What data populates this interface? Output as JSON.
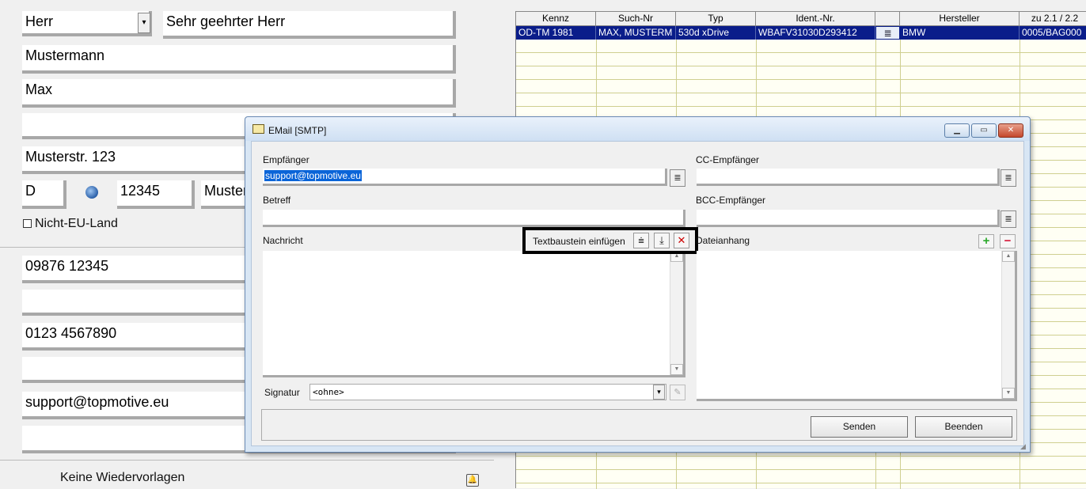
{
  "customer": {
    "salutation": "Herr",
    "letter_salutation": "Sehr geehrter Herr",
    "last_name": "Mustermann",
    "first_name": "Max",
    "street": "Musterstr. 123",
    "country": "D",
    "zip": "12345",
    "city": "Muster",
    "non_eu_label": "Nicht-EU-Land",
    "phone": "09876 12345",
    "mobile": "0123 4567890",
    "email": "support@topmotive.eu",
    "followups": "Keine Wiedervorlagen"
  },
  "vehicles": {
    "columns": [
      "Kennz",
      "Such-Nr",
      "Typ",
      "Ident.-Nr.",
      "",
      "Hersteller",
      "zu 2.1 / 2.2"
    ],
    "rows": [
      [
        "OD-TM 1981",
        "MAX, MUSTERM",
        "530d xDrive",
        "WBAFV31030D293412",
        "≣",
        "BMW",
        "0005/BAG000"
      ]
    ]
  },
  "email_dialog": {
    "title": "EMail [SMTP]",
    "recipient_label": "Empfänger",
    "recipient_value": "support@topmotive.eu",
    "cc_label": "CC-Empfänger",
    "subject_label": "Betreff",
    "bcc_label": "BCC-Empfänger",
    "message_label": "Nachricht",
    "textblock_label": "Textbaustein einfügen",
    "attachment_label": "Dateianhang",
    "signature_label": "Signatur",
    "signature_value": "<ohne>",
    "send_button": "Senden",
    "close_button": "Beenden"
  }
}
